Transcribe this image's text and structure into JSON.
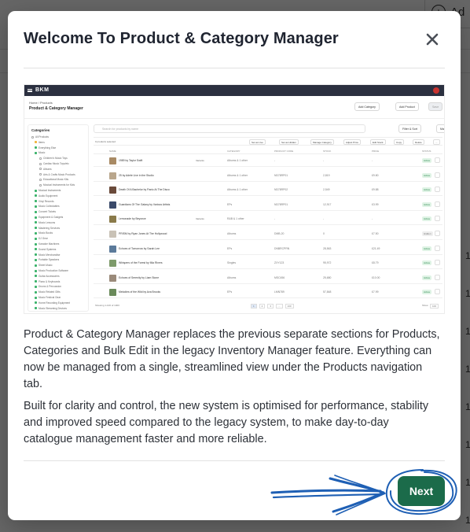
{
  "background": {
    "add_button_label": "Ad",
    "row_numbers": [
      "1",
      "1",
      "1",
      "1",
      "1",
      "1",
      "1",
      "1"
    ]
  },
  "modal": {
    "title": "Welcome To Product & Category Manager",
    "close_icon": "close-icon",
    "paragraphs": [
      "Product & Category Manager replaces the previous separate sections for Products, Categories and Bulk Edit in the legacy Inventory Manager feature. Everything can now be managed from a single, streamlined view under the Products navigation tab.",
      "Built for clarity and control, the new system is optimised for performance, stability and improved speed compared to the legacy system, to make day-to-day catalogue management faster and more reliable."
    ],
    "next_label": "Next",
    "accent_color": "#1b6b4a",
    "annotation_color": "#1e5fb4"
  },
  "preview": {
    "logo": "BKM",
    "breadcrumb": "Home  /  Products",
    "page_title": "Product & Category Manager",
    "buttons": [
      "Add Category",
      "Add Product",
      "Save"
    ],
    "sidebar_title": "Categories",
    "sidebar_items": [
      "All Products",
      "Items",
      "Everything Else",
      "Music",
      "Children's Music Toys",
      "Cardiac Music Toys/etc",
      "Albums",
      "Arts & Crafts Music Products",
      "Educational Music Kits",
      "Musical Instruments for Kids",
      "Musical Instruments",
      "Audio Equipment",
      "Vinyl Records",
      "Music Collectables",
      "Concert Tickets",
      "Equipment & Gadgets",
      "Music Lessons",
      "Mastering Services",
      "Music Books",
      "DJ Gear",
      "Karaoke Machines",
      "Sound Systems",
      "Music Merchandise",
      "Portable Speakers",
      "Sheet Music",
      "Music Production Software",
      "Guitar Accessories",
      "Piano & Keyboards",
      "Drums & Percussion",
      "Music Related Gifts",
      "Music Festival Gear",
      "Home Recording Equipment",
      "Music Streaming Devices"
    ],
    "search_placeholder": "Search for products by name",
    "filter_label": "Filter & Sort",
    "columns_label": "Manage Columns",
    "selected_label": "0 products selected",
    "toolbar": [
      "Set as Live",
      "Set as Hidden",
      "Manage Category",
      "Adjust Price",
      "Edit Stock",
      "Copy",
      "Delete",
      "..."
    ],
    "table_headers": [
      "NAME",
      "CATEGORY",
      "PRODUCT CODE",
      "STOCK",
      "PRICE",
      "STATUS"
    ],
    "rows": [
      {
        "name": "1989 by Taylor Swift",
        "variant": "Variants",
        "category": "Albums & 1 other",
        "code": "-",
        "stock": "-",
        "price": "-",
        "status": "Active"
      },
      {
        "name": "25 by Adele Live in the Studio",
        "variant": "",
        "category": "Albums & 1 other",
        "code": "ND78RP01",
        "stock": "2,819",
        "price": "£9.80",
        "status": "Active"
      },
      {
        "name": "Death Of A Bachelor by Panic At The Disco",
        "variant": "",
        "category": "Albums & 1 other",
        "code": "ND78RP02",
        "stock": "2,549",
        "price": "£9.88",
        "status": "Active"
      },
      {
        "name": "Guardians Of The Galaxy by Various Artists",
        "variant": "",
        "category": "EPs",
        "code": "ND78RP01",
        "stock": "12,917",
        "price": "£3.99",
        "status": "Active"
      },
      {
        "name": "Lemonade by Beyonce",
        "variant": "Variants",
        "category": "R&B & 1 other",
        "code": "-",
        "stock": "-",
        "price": "-",
        "status": "Active"
      },
      {
        "name": "PRISM by Ryan Jones At The Hollywood",
        "variant": "",
        "category": "Albums",
        "code": "DMB-20",
        "stock": "0",
        "price": "£7.50",
        "status": "Hidden"
      },
      {
        "name": "Echoes of Tomorrow by Sarah Lee",
        "variant": "",
        "category": "EPs",
        "code": "DNBRCPRN",
        "stock": "28,563",
        "price": "£21.49",
        "status": "Active"
      },
      {
        "name": "Whispers of the Forest by Mia Rivers",
        "variant": "",
        "category": "Singles",
        "code": "ZXY123",
        "stock": "95,972",
        "price": "£8.79",
        "status": "Active"
      },
      {
        "name": "Echoes of Serenity by Liam Stone",
        "variant": "",
        "category": "Albums",
        "code": "MSC456",
        "stock": "25,680",
        "price": "£10.00",
        "status": "Active"
      },
      {
        "name": "Melodies of the Wild by Ava Brooks",
        "variant": "",
        "category": "EPs",
        "code": "LMN789",
        "stock": "57,848",
        "price": "£7.99",
        "status": "Active"
      }
    ],
    "pager_label": "Showing 1-100 of 1000",
    "pages": [
      "1",
      "2",
      "3",
      "...",
      "100"
    ],
    "show_label": "Show",
    "show_value": "100"
  }
}
